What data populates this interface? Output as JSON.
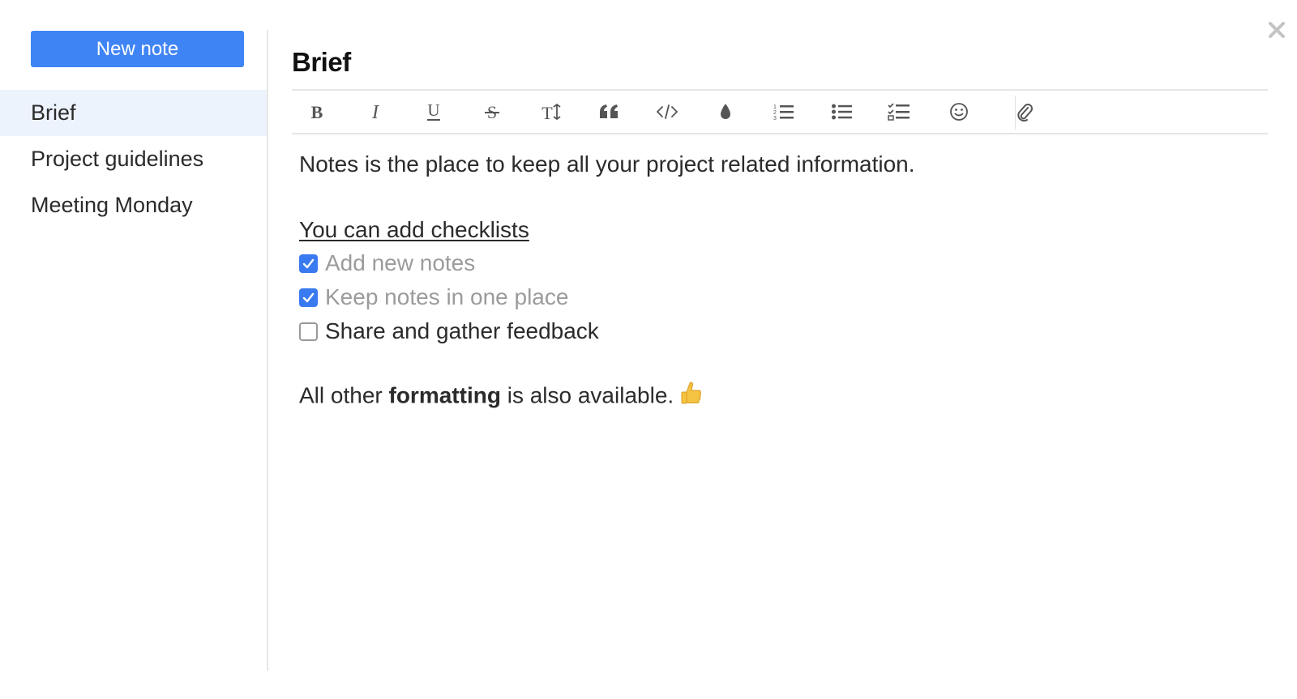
{
  "sidebar": {
    "new_note_label": "New note",
    "notes": [
      {
        "label": "Brief",
        "active": true
      },
      {
        "label": "Project guidelines",
        "active": false
      },
      {
        "label": "Meeting Monday",
        "active": false
      }
    ]
  },
  "editor": {
    "title": "Brief",
    "toolbar_icons": [
      "bold-icon",
      "italic-icon",
      "underline-icon",
      "strikethrough-icon",
      "text-size-icon",
      "quote-icon",
      "code-icon",
      "color-drop-icon",
      "ordered-list-icon",
      "bullet-list-icon",
      "checklist-icon",
      "emoji-icon",
      "attachment-icon"
    ],
    "content": {
      "intro": "Notes is the place to keep all your project related information.",
      "checklist_heading": "You can add checklists",
      "checklist": [
        {
          "label": "Add new notes",
          "checked": true
        },
        {
          "label": "Keep notes in one place",
          "checked": true
        },
        {
          "label": "Share and gather feedback",
          "checked": false
        }
      ],
      "outro_before": "All other ",
      "outro_bold": "formatting",
      "outro_after": " is also available.",
      "outro_emoji": "thumbs-up-icon"
    }
  },
  "colors": {
    "accent": "#3f84f4",
    "active_item_bg": "#edf3fd",
    "checked_box": "#3a7af0",
    "done_text": "#9b9b9b"
  }
}
